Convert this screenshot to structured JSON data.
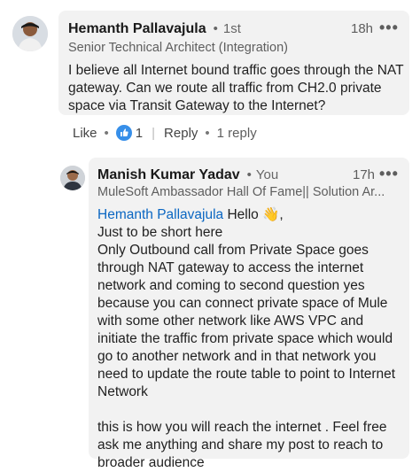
{
  "comment": {
    "author": "Hemanth Pallavajula",
    "degree": "1st",
    "headline": "Senior Technical Architect (Integration)",
    "time": "18h",
    "more_icon": "more-horizontal-icon",
    "text": "I believe all Internet bound traffic goes through the NAT gateway. Can we route all traffic from CH2.0 private space via Transit Gateway to the Internet?",
    "actions": {
      "like_label": "Like",
      "reaction_icon": "thumbs-up-reaction-icon",
      "reaction_count": "1",
      "reply_label": "Reply",
      "reply_count": "1 reply"
    }
  },
  "reply": {
    "author": "Manish Kumar Yadav",
    "degree": "You",
    "headline": "MuleSoft Ambassador Hall Of Fame|| Solution Ar...",
    "time": "17h",
    "more_icon": "more-horizontal-icon",
    "mention": "Hemanth Pallavajula",
    "greeting": "Hello 👋,",
    "line2": "Just to be short here",
    "paragraph": "Only Outbound call from Private Space goes through NAT gateway to access the internet network and coming to second question yes because you can connect private space of Mule with some other network like AWS VPC and initiate the traffic from private space which would go to another network and in that network you need to update the route table to point to Internet Network",
    "closing": "this is how you will reach the internet . Feel free ask me anything and share my post to reach to broader audience"
  },
  "colors": {
    "mention": "#0a66c2",
    "bubble": "#f2f2f2",
    "reaction": "#378fe9"
  }
}
